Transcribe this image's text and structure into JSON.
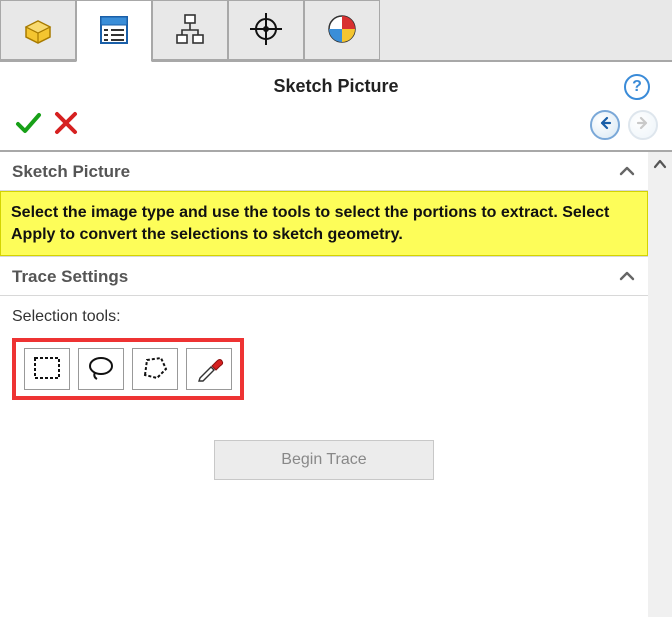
{
  "title": "Sketch Picture",
  "sections": {
    "sketch_picture": {
      "title": "Sketch Picture",
      "info": "Select the image type and use the tools to select the portions to extract. Select Apply to convert the selections to sketch geometry."
    },
    "trace_settings": {
      "title": "Trace Settings",
      "selection_label": "Selection tools:",
      "begin_trace_label": "Begin Trace"
    }
  },
  "icons": {
    "help_glyph": "?"
  }
}
